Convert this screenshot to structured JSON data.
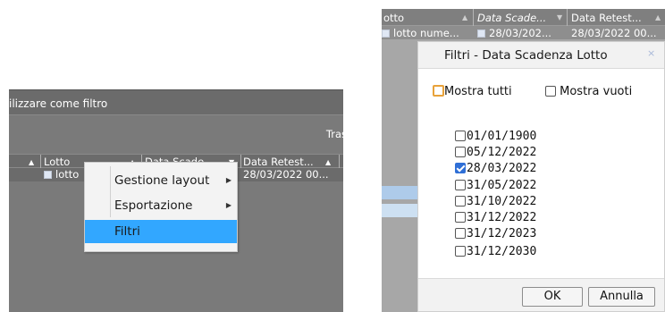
{
  "left": {
    "toolbar_text": "ilizzare come filtro",
    "trash_text": "Tras",
    "columns": [
      {
        "label": "Lotto"
      },
      {
        "label": "Data Scade..."
      },
      {
        "label": "Data Retest..."
      }
    ],
    "row": {
      "lotto": "lotto",
      "data_retest": "28/03/2022 00..."
    },
    "context_menu": {
      "items": [
        {
          "label": "Gestione layout",
          "submenu": true
        },
        {
          "label": "Esportazione",
          "submenu": true
        },
        {
          "label": "Filtri",
          "submenu": false,
          "active": true
        }
      ]
    }
  },
  "right": {
    "columns": [
      {
        "label": "otto"
      },
      {
        "label": "Data Scade..."
      },
      {
        "label": "Data Retest..."
      }
    ],
    "row": {
      "lotto": "lotto nume...",
      "data_scadenza": "28/03/202...",
      "data_retest": "28/03/2022 00..."
    },
    "dialog": {
      "title": "Filtri - Data Scadenza Lotto",
      "close_glyph": "×",
      "show_all_label": "Mostra tutti",
      "show_empty_label": "Mostra vuoti",
      "dates": [
        {
          "label": "01/01/1900",
          "checked": false
        },
        {
          "label": "05/12/2022",
          "checked": false
        },
        {
          "label": "28/03/2022",
          "checked": true
        },
        {
          "label": "31/05/2022",
          "checked": false
        },
        {
          "label": "31/10/2022",
          "checked": false
        },
        {
          "label": "31/12/2022",
          "checked": false
        },
        {
          "label": "31/12/2023",
          "checked": false
        },
        {
          "label": "31/12/2030",
          "checked": false
        }
      ],
      "ok_label": "OK",
      "cancel_label": "Annulla"
    }
  },
  "colors": {
    "grid_dark": "#6b6b6b",
    "menu_active": "#32a7ff",
    "checkbox_checked": "#2f6fd6",
    "checkbox_highlight": "#e8a23a"
  }
}
